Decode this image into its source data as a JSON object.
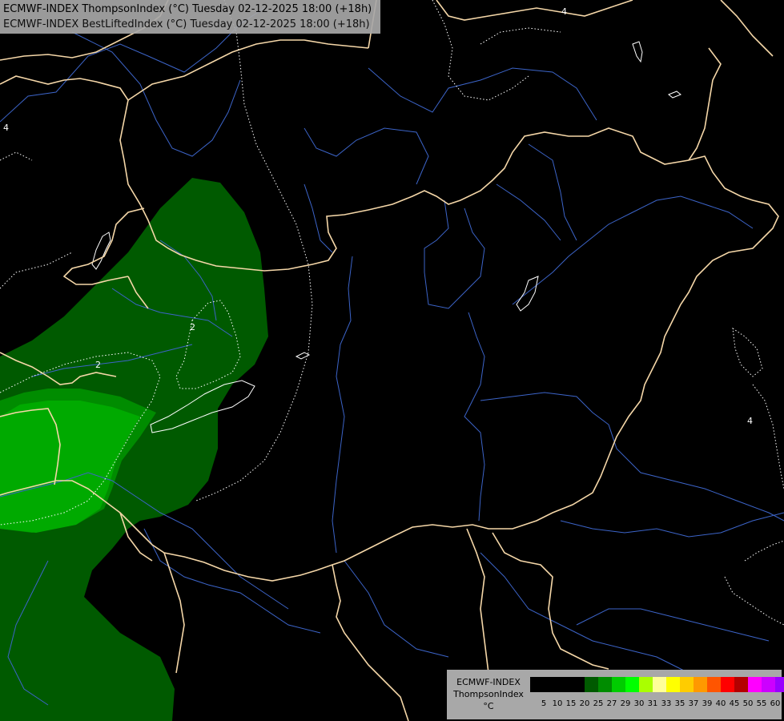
{
  "title": {
    "line1": "ECMWF-INDEX ThompsonIndex (°C) Tuesday 02-12-2025 18:00 (+18h)",
    "line2": "ECMWF-INDEX BestLiftedIndex (°C) Tuesday 02-12-2025 18:00 (+18h)"
  },
  "legend": {
    "source": "ECMWF-INDEX",
    "parameter": "ThompsonIndex",
    "unit": "°C",
    "colors": [
      "#000000",
      "#000000",
      "#000000",
      "#000000",
      "#005a00",
      "#008c00",
      "#00cc00",
      "#00ff00",
      "#aaff00",
      "#ffff99",
      "#ffff00",
      "#ffcc00",
      "#ff9900",
      "#ff5500",
      "#ff0000",
      "#b40000",
      "#ff00ff",
      "#cc00ff",
      "#9900ff",
      "#6600ff",
      "#0000ff"
    ],
    "ticks": [
      "5",
      "10",
      "15",
      "20",
      "25",
      "27",
      "29",
      "30",
      "31",
      "33",
      "35",
      "37",
      "39",
      "40",
      "45",
      "50",
      "55",
      "60"
    ]
  },
  "map": {
    "contour_labels": [
      "2",
      "2",
      "4",
      "4",
      "4"
    ],
    "colors": {
      "zone_dark_green": "#005a00",
      "zone_green": "#008c00",
      "zone_light_green": "#00aa00",
      "borders": "#f5d7a8",
      "rivers": "#3c64c8",
      "contours": "#ffffff"
    }
  }
}
